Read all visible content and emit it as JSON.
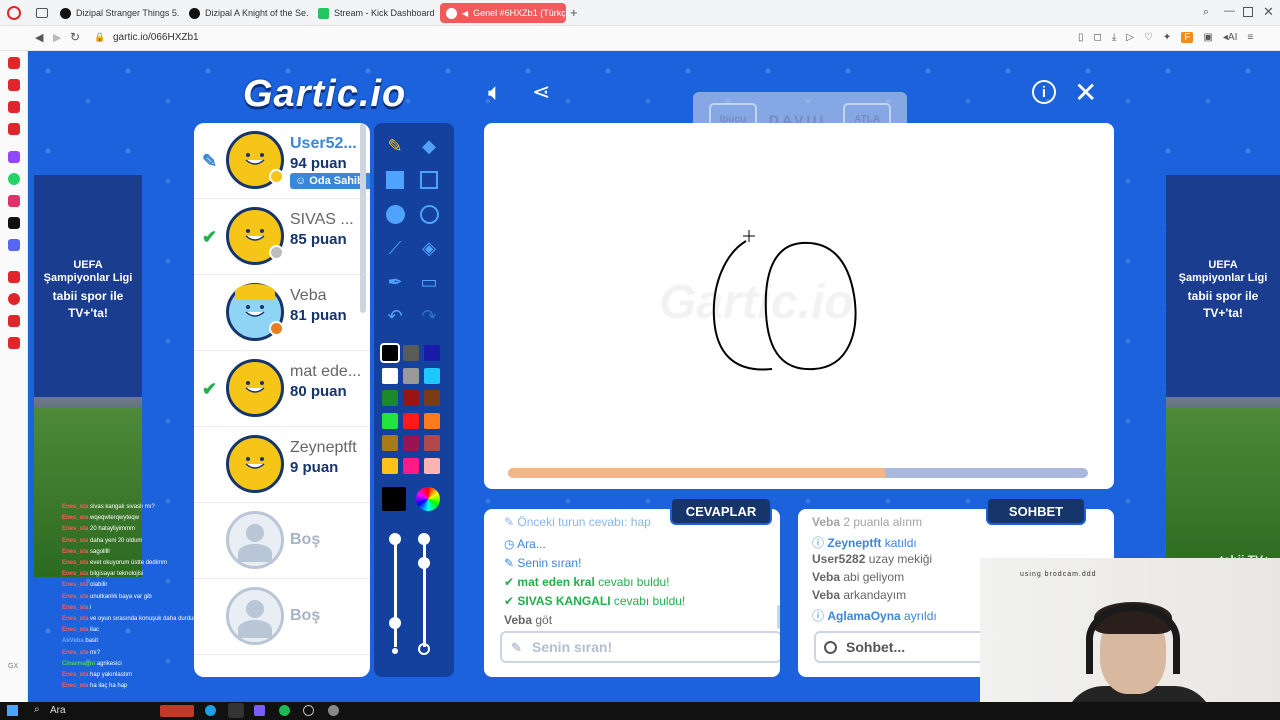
{
  "browser": {
    "tabs": [
      {
        "label": "Dizipal Stranger Things 5..."
      },
      {
        "label": "Dizipal A Knight of the Se..."
      },
      {
        "label": "Stream - Kick Dashboard"
      },
      {
        "label": "Genel #6HXZb1 (Türkç..."
      }
    ],
    "url": "gartic.io/066HXZb1"
  },
  "game": {
    "logo": "Gartic.io",
    "word_box": {
      "skip_left": "Ipucu",
      "word": "DAVUL",
      "skip_right": "ATLA"
    },
    "canvas_watermark": "Gartic.io",
    "progress": 0.65,
    "players": [
      {
        "name": "User52...",
        "score": "94 puan",
        "badge": "Oda Sahibi",
        "status": "drawing",
        "dot_color": "#f5c518"
      },
      {
        "name": "SIVAS ...",
        "score": "85 puan",
        "status": "guessed",
        "dot_color": "#bdbdbd"
      },
      {
        "name": "Veba",
        "score": "81 puan",
        "status": "",
        "dot_color": "#e67e22"
      },
      {
        "name": "mat ede...",
        "score": "80 puan",
        "status": "guessed"
      },
      {
        "name": "Zeyneptft",
        "score": "9 puan",
        "status": ""
      },
      {
        "empty": "Boş"
      },
      {
        "empty": "Boş"
      }
    ],
    "answers": {
      "title": "CEVAPLAR",
      "messages": [
        {
          "icon": "pen",
          "text": "Önceki turun cevabı: hap",
          "faded": true
        },
        {
          "icon": "clock",
          "text": "Ara..."
        },
        {
          "icon": "pen",
          "text": "Senin sıran!"
        },
        {
          "icon": "check",
          "bold": "mat eden kral",
          "text": " cevabı buldu!"
        },
        {
          "icon": "check",
          "bold": "SIVAS KANGALI",
          "text": " cevabı buldu!"
        },
        {
          "icon": "",
          "bold": "Veba",
          "text": " göt"
        }
      ],
      "input_placeholder": "Senin sıran!"
    },
    "chat": {
      "title": "SOHBET",
      "messages": [
        {
          "bold": "Veba",
          "text": " 2 puanla alınm",
          "faded": true
        },
        {
          "icon": "info",
          "bold": "Zeyneptft",
          "text": " katıldı"
        },
        {
          "bold": "User5282",
          "text": " uzay mekiği"
        },
        {
          "bold": "Veba",
          "text": " abi geliyom"
        },
        {
          "bold": "Veba",
          "text": " arkandayım"
        },
        {
          "icon": "info",
          "bold": "AglamaOyna",
          "text": " ayrıldı"
        }
      ],
      "input_placeholder": "Sohbet..."
    },
    "colors": [
      "#000000",
      "#5a5a5a",
      "#1a1aa8",
      "#ffffff",
      "#9a9a9a",
      "#1ec8ff",
      "#1b8a2c",
      "#9b1414",
      "#7a3b16",
      "#22e43a",
      "#ff1a1a",
      "#ff7a1a",
      "#a87a1a",
      "#9a1454",
      "#b04a4a",
      "#ffc21a",
      "#ff1a8a",
      "#ffb3b3"
    ],
    "ad": {
      "title": "UEFA\nŞampiyonlar Ligi",
      "brand": "tabii spor ile",
      "tv": "TV+'ta!",
      "footer": "tabii TV+"
    }
  },
  "stream_chat": [
    {
      "user": "Enes_sta",
      "msg": "sivas kangalı sivaslı mı?"
    },
    {
      "user": "Enes_sta",
      "msg": "wqeqwterqwyteqw"
    },
    {
      "user": "Enes_sta",
      "msg": "20 hatayliyimmm"
    },
    {
      "user": "Enes_sta",
      "msg": "daha yeni 20 oldum"
    },
    {
      "user": "Enes_sta",
      "msg": "sagolllll"
    },
    {
      "user": "Enes_sta",
      "msg": "evet okuyorum üstte dedimm"
    },
    {
      "user": "Enes_sta",
      "msg": "bilgisayar teknolojisi"
    },
    {
      "user": "Enes_sta",
      "msg": "olabilir"
    },
    {
      "user": "Enes_sta",
      "msg": "unutkanlık baya var gib"
    },
    {
      "user": "Enes_sta",
      "msg": "i"
    },
    {
      "user": "Enes_sta",
      "msg": "ve oyun sırasında konuşuk daha durdurs"
    },
    {
      "user": "Enes_sta",
      "msg": "ilac"
    },
    {
      "user": "AkVeba",
      "msg": "basit"
    },
    {
      "user": "Enes_sta",
      "msg": "mı?"
    },
    {
      "user": "Cinarmagni",
      "msg": "agrikesici"
    },
    {
      "user": "Enes_sta",
      "msg": "hap yakınlastım"
    },
    {
      "user": "Enes_sta",
      "msg": "ha ilaç ha hap"
    }
  ],
  "webcam": {
    "label": "using brodcam.ddd"
  },
  "taskbar": {
    "search": "Ara"
  }
}
